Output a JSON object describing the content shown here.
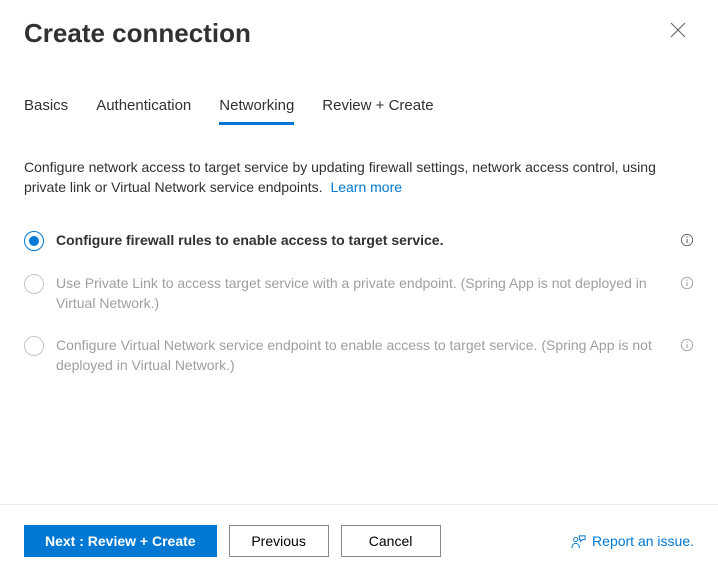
{
  "header": {
    "title": "Create connection"
  },
  "tabs": {
    "basics": "Basics",
    "authentication": "Authentication",
    "networking": "Networking",
    "review": "Review + Create"
  },
  "description": {
    "text": "Configure network access to target service by updating firewall settings, network access control, using private link or Virtual Network service endpoints.",
    "learn_more": "Learn more"
  },
  "options": {
    "firewall": "Configure firewall rules to enable access to target service.",
    "private_link": "Use Private Link to access target service with a private endpoint. (Spring App is not deployed in Virtual Network.)",
    "vnet": "Configure Virtual Network service endpoint to enable access to target service. (Spring App is not deployed in Virtual Network.)"
  },
  "footer": {
    "next": "Next : Review + Create",
    "previous": "Previous",
    "cancel": "Cancel",
    "report": "Report an issue."
  }
}
